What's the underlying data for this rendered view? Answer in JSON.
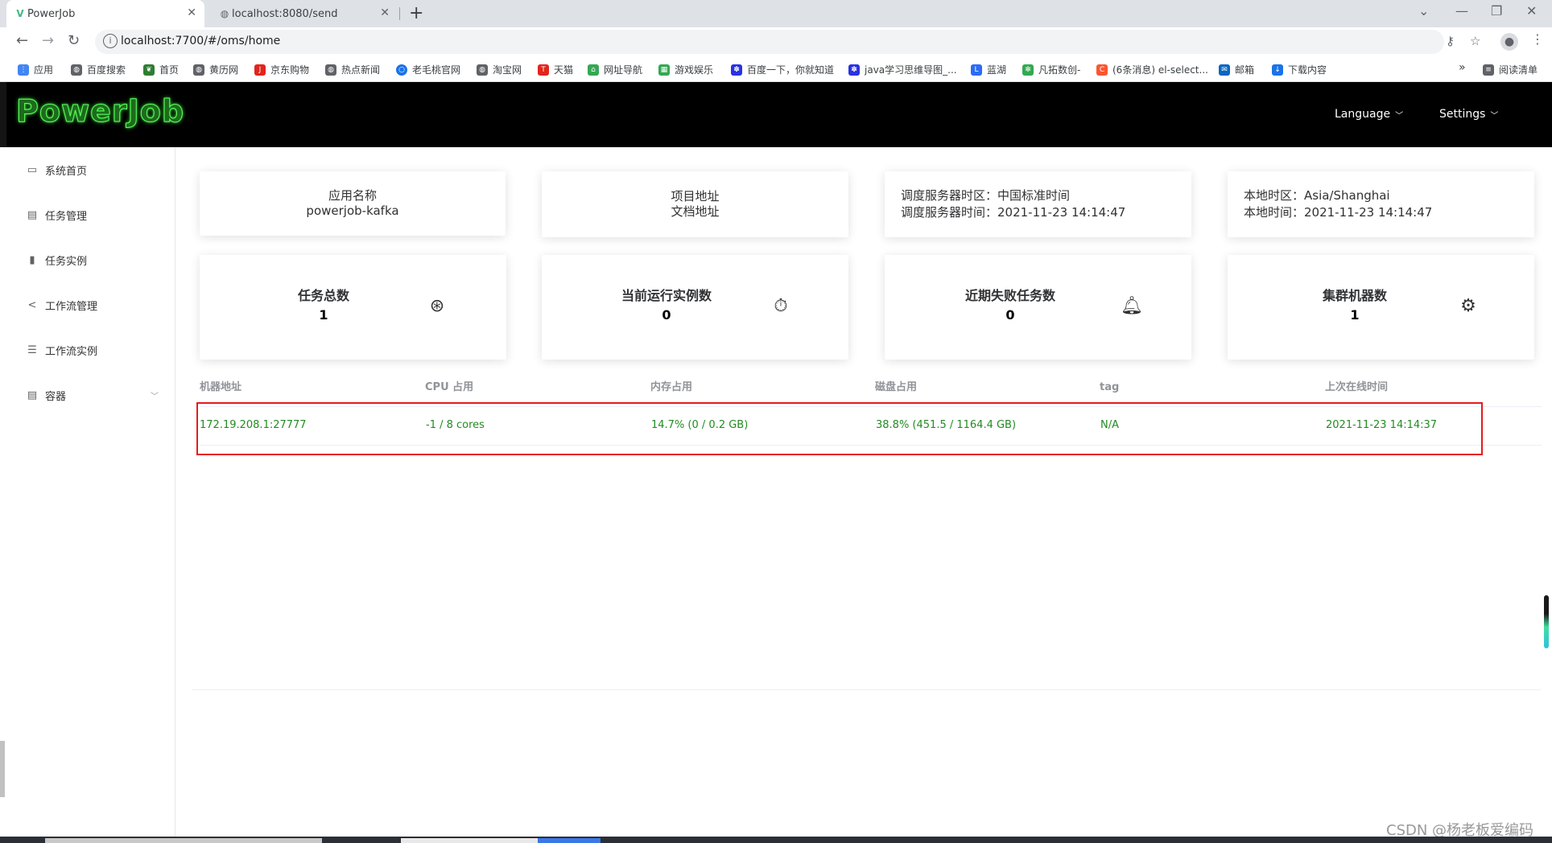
{
  "browser": {
    "tabs": [
      {
        "title": "PowerJob",
        "favicon": "V"
      },
      {
        "title": "localhost:8080/send",
        "favicon": "globe-icon"
      }
    ],
    "url": "localhost:7700/#/oms/home",
    "bookmarks": [
      {
        "label": "应用",
        "icon": "apps-grid-icon",
        "color": "#4285f4"
      },
      {
        "label": "百度搜索",
        "icon": "globe-icon",
        "color": "#5f6368"
      },
      {
        "label": "首页",
        "icon": "leaf-icon",
        "color": "#2e7d32"
      },
      {
        "label": "黄历网",
        "icon": "globe-icon",
        "color": "#5f6368"
      },
      {
        "label": "京东购物",
        "icon": "jd-icon",
        "color": "#e1251b"
      },
      {
        "label": "热点新闻",
        "icon": "globe-icon",
        "color": "#5f6368"
      },
      {
        "label": "老毛桃官网",
        "icon": "circle-icon",
        "color": "#1a73e8"
      },
      {
        "label": "淘宝网",
        "icon": "globe-icon",
        "color": "#5f6368"
      },
      {
        "label": "天猫",
        "icon": "tmall-icon",
        "color": "#e1251b"
      },
      {
        "label": "网址导航",
        "icon": "house-icon",
        "color": "#34a853"
      },
      {
        "label": "游戏娱乐",
        "icon": "grid-icon",
        "color": "#34a853"
      },
      {
        "label": "百度一下，你就知道",
        "icon": "paw-icon",
        "color": "#2932e1"
      },
      {
        "label": "java学习思维导图_...",
        "icon": "paw-icon",
        "color": "#2932e1"
      },
      {
        "label": "蓝湖",
        "icon": "lanhu-icon",
        "color": "#2b6cf6"
      },
      {
        "label": "凡拓数创-",
        "icon": "gear-icon",
        "color": "#34a853"
      },
      {
        "label": "(6条消息) el-select...",
        "icon": "csdn-icon",
        "color": "#fc5531"
      },
      {
        "label": "邮箱",
        "icon": "mail-icon",
        "color": "#0a66c2"
      },
      {
        "label": "下载内容",
        "icon": "download-icon",
        "color": "#1a73e8"
      }
    ],
    "more": "»",
    "reading_list": "阅读清单"
  },
  "header": {
    "logo": "PowerJob",
    "language": "Language",
    "settings": "Settings"
  },
  "sidebar": {
    "items": [
      {
        "label": "系统首页",
        "icon": "monitor-icon"
      },
      {
        "label": "任务管理",
        "icon": "task-board-icon"
      },
      {
        "label": "任务实例",
        "icon": "bar-chart-icon"
      },
      {
        "label": "工作流管理",
        "icon": "share-icon"
      },
      {
        "label": "工作流实例",
        "icon": "sliders-icon"
      },
      {
        "label": "容器",
        "icon": "container-icon"
      }
    ]
  },
  "info_cards": {
    "app": {
      "line1": "应用名称",
      "line2": "powerjob-kafka"
    },
    "project": {
      "line1": "项目地址",
      "line2": "文档地址"
    },
    "server": {
      "line1": "调度服务器时区：中国标准时间",
      "line2": "调度服务器时间：2021-11-23 14:14:47"
    },
    "local": {
      "line1": "本地时区：Asia/Shanghai",
      "line2": "本地时间：2021-11-23 14:14:47"
    }
  },
  "stat_cards": [
    {
      "label": "任务总数",
      "value": "1",
      "icon": "aperture-icon"
    },
    {
      "label": "当前运行实例数",
      "value": "0",
      "icon": "stopwatch-icon"
    },
    {
      "label": "近期失败任务数",
      "value": "0",
      "icon": "bell-icon"
    },
    {
      "label": "集群机器数",
      "value": "1",
      "icon": "cpu-icon"
    }
  ],
  "table": {
    "columns": [
      "机器地址",
      "CPU 占用",
      "内存占用",
      "磁盘占用",
      "tag",
      "上次在线时间"
    ],
    "rows": [
      [
        "172.19.208.1:27777",
        "-1 / 8 cores",
        "14.7%  (0 / 0.2 GB)",
        "38.8%  (451.5 / 1164.4 GB)",
        "N/A",
        "2021-11-23 14:14:37"
      ]
    ]
  },
  "colors": {
    "header_bg": "#000000",
    "logo_green": "#5dff5d",
    "table_text_green": "#228b22",
    "highlight_red": "#e51c1c"
  },
  "watermark": "CSDN @杨老板爱编码"
}
